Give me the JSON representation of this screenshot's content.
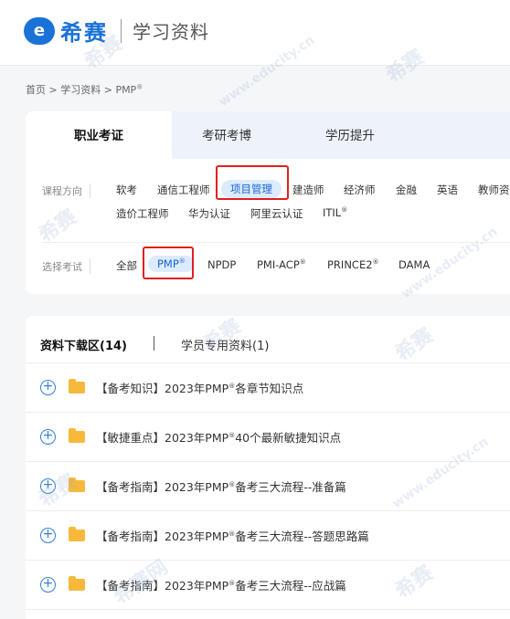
{
  "header": {
    "logo_mark": "e",
    "logo_text": "希赛",
    "section_title": "学习资料"
  },
  "breadcrumb": {
    "home": "首页",
    "sep": " > ",
    "section": "学习资料",
    "current": "PMP",
    "reg": "®"
  },
  "category_tabs": [
    {
      "label": "职业考证",
      "active": true
    },
    {
      "label": "考研考博",
      "active": false
    },
    {
      "label": "学历提升",
      "active": false
    }
  ],
  "course_direction": {
    "label": "课程方向",
    "row1": [
      "软考",
      "通信工程师",
      "项目管理",
      "建造师",
      "经济师",
      "金融",
      "英语",
      "教师资"
    ],
    "row2": [
      "造价工程师",
      "华为认证",
      "阿里云认证",
      "ITIL"
    ],
    "selected": "项目管理",
    "reg": "®"
  },
  "exam_select": {
    "label": "选择考试",
    "options": [
      "全部",
      "PMP",
      "NPDP",
      "PMI-ACP",
      "PRINCE2",
      "DAMA"
    ],
    "selected": "PMP",
    "reg": "®"
  },
  "list_tabs": [
    {
      "label": "资料下载区(14)",
      "active": true
    },
    {
      "label": "学员专用资料(1)",
      "active": false
    }
  ],
  "items": [
    {
      "pre": "【备考知识】2023年PMP",
      "reg": "®",
      "post": "各章节知识点"
    },
    {
      "pre": "【敏捷重点】2023年PMP",
      "reg": "®",
      "post": "40个最新敏捷知识点"
    },
    {
      "pre": "【备考指南】2023年PMP",
      "reg": "®",
      "post": "备考三大流程--准备篇"
    },
    {
      "pre": "【备考指南】2023年PMP",
      "reg": "®",
      "post": "备考三大流程--答题思路篇"
    },
    {
      "pre": "【备考指南】2023年PMP",
      "reg": "®",
      "post": "备考三大流程--应战篇"
    }
  ],
  "watermarks": [
    "希赛",
    "www.educity.cn",
    "希赛网"
  ],
  "colors": {
    "accent": "#1a72d8",
    "highlight_box": "#e02020",
    "folder": "#f6b93b"
  }
}
